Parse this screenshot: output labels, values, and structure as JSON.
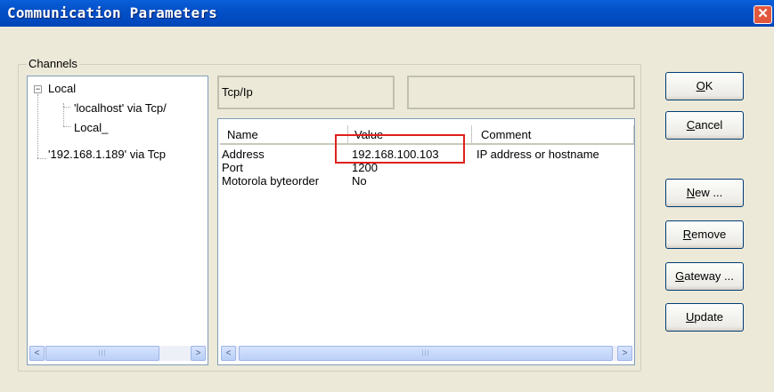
{
  "window": {
    "title": "Communication Parameters",
    "close_symbol": "✕"
  },
  "channels": {
    "group_label": "Channels",
    "tree": {
      "expander": "−",
      "root_label": "Local",
      "children": [
        "'localhost' via Tcp/",
        "Local_"
      ],
      "sibling_label": "'192.168.1.189' via Tcp"
    }
  },
  "driver": {
    "name": "Tcp/Ip",
    "secondary": ""
  },
  "table": {
    "columns": [
      "Name",
      "Value",
      "Comment"
    ],
    "rows": [
      [
        "Address",
        "192.168.100.103",
        "IP address or hostname"
      ],
      [
        "Port",
        "1200",
        ""
      ],
      [
        "Motorola byteorder",
        "No",
        ""
      ]
    ]
  },
  "scroll": {
    "left_arrow": "<",
    "right_arrow": ">",
    "thumb_grip": "|||"
  },
  "buttons": {
    "ok": {
      "accel": "O",
      "rest": "K"
    },
    "cancel": {
      "accel": "C",
      "rest": "ancel"
    },
    "new": {
      "accel": "N",
      "rest": "ew ..."
    },
    "remove": {
      "accel": "R",
      "rest": "emove"
    },
    "gateway": {
      "accel": "G",
      "rest": "ateway ..."
    },
    "update": {
      "accel": "U",
      "rest": "pdate"
    }
  },
  "colors": {
    "titlebar": "#0350c8",
    "highlight_box": "#e0201e",
    "dialog_bg": "#ece9d8"
  }
}
